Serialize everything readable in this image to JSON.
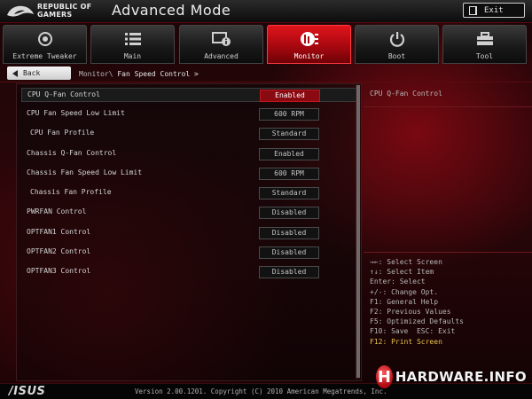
{
  "header": {
    "brand_line1": "REPUBLIC OF",
    "brand_line2": "GAMERS",
    "mode_title": "Advanced Mode",
    "exit_label": "Exit"
  },
  "tabs": [
    {
      "label": "Extreme Tweaker",
      "icon": "extreme-tweaker-icon"
    },
    {
      "label": "Main",
      "icon": "list-icon"
    },
    {
      "label": "Advanced",
      "icon": "advanced-settings-icon"
    },
    {
      "label": "Monitor",
      "icon": "monitor-icon",
      "active": true
    },
    {
      "label": "Boot",
      "icon": "power-icon"
    },
    {
      "label": "Tool",
      "icon": "toolbox-icon"
    }
  ],
  "navigation": {
    "back_label": "Back",
    "breadcrumb_parent": "Monitor\\",
    "breadcrumb_current": "Fan Speed Control >"
  },
  "settings": [
    {
      "label": "CPU Q-Fan Control",
      "value": "Enabled",
      "selected": true
    },
    {
      "label": "CPU Fan Speed Low Limit",
      "value": "600 RPM"
    },
    {
      "label": "CPU Fan Profile",
      "value": "Standard",
      "indent": true
    },
    {
      "label": "Chassis Q-Fan Control",
      "value": "Enabled"
    },
    {
      "label": "Chassis Fan Speed Low Limit",
      "value": "600 RPM"
    },
    {
      "label": "Chassis Fan Profile",
      "value": "Standard",
      "indent": true
    },
    {
      "label": "PWRFAN Control",
      "value": "Disabled"
    },
    {
      "label": "OPTFAN1 Control",
      "value": "Disabled"
    },
    {
      "label": "OPTFAN2 Control",
      "value": "Disabled"
    },
    {
      "label": "OPTFAN3 Control",
      "value": "Disabled"
    }
  ],
  "help": {
    "description": "CPU Q-Fan Control"
  },
  "key_help": [
    "→←: Select Screen",
    "↑↓: Select Item",
    "Enter: Select",
    "+/-: Change Opt.",
    "F1: General Help",
    "F2: Previous Values",
    "F5: Optimized Defaults",
    "F10: Save  ESC: Exit",
    "F12: Print Screen"
  ],
  "footer": {
    "logo_text": "/ISUS",
    "version": "Version 2.00.1201. Copyright (C) 2010 American Megatrends, Inc."
  },
  "watermark": {
    "text": "HARDWARE.INFO"
  },
  "colors": {
    "accent_red": "#c4141d",
    "tab_active": "#e0141c",
    "highlight_key": "#e9c14a"
  }
}
